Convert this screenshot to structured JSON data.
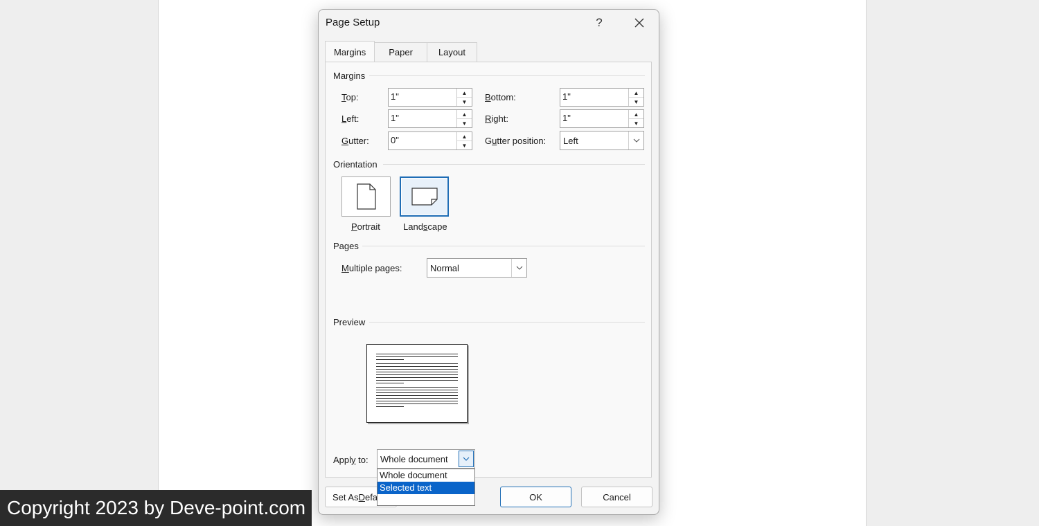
{
  "dialog": {
    "title": "Page Setup",
    "help_label": "?",
    "tabs": [
      "Margins",
      "Paper",
      "Layout"
    ],
    "active_tab": "Margins"
  },
  "margins": {
    "group_label": "Margins",
    "top_label_u": "T",
    "top_label_rest": "op:",
    "top_value": "1\"",
    "bottom_label_u": "B",
    "bottom_label_rest": "ottom:",
    "bottom_value": "1\"",
    "left_label_u": "L",
    "left_label_rest": "eft:",
    "left_value": "1\"",
    "right_label_u": "R",
    "right_label_rest": "ight:",
    "right_value": "1\"",
    "gutter_label_u": "G",
    "gutter_label_rest": "utter:",
    "gutter_value": "0\"",
    "gutter_pos_label_pre": "G",
    "gutter_pos_label_u": "u",
    "gutter_pos_label_rest": "tter position:",
    "gutter_pos_value": "Left"
  },
  "orientation": {
    "group_label": "Orientation",
    "portrait_u": "P",
    "portrait_rest": "ortrait",
    "landscape_pre": "Land",
    "landscape_u": "s",
    "landscape_rest": "cape",
    "selected": "Landscape"
  },
  "pages": {
    "group_label": "Pages",
    "multiple_label_u": "M",
    "multiple_label_rest": "ultiple pages:",
    "multiple_value": "Normal"
  },
  "preview": {
    "group_label": "Preview"
  },
  "apply": {
    "label_pre": "Appl",
    "label_u": "y",
    "label_rest": " to:",
    "value": "Whole document",
    "options": [
      "Whole document",
      "Selected text"
    ],
    "highlighted": "Selected text"
  },
  "buttons": {
    "set_default_pre": "Set As ",
    "set_default_u": "D",
    "set_default_rest": "efa",
    "ok": "OK",
    "cancel": "Cancel"
  },
  "watermark": "Copyright 2023 by Deve-point.com",
  "colors": {
    "accent": "#1f6db5",
    "selection": "#0a64c9"
  }
}
